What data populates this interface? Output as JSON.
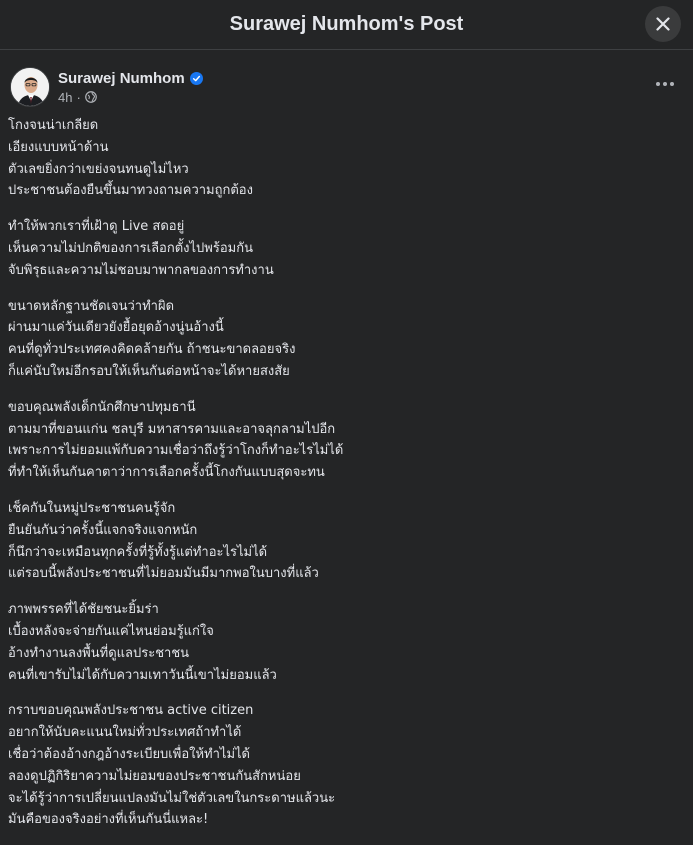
{
  "header": {
    "title": "Surawej Numhom's Post",
    "close_icon": "close-icon"
  },
  "post": {
    "author": "Surawej Numhom",
    "verified": true,
    "time": "4h",
    "dot": "·",
    "privacy_icon": "globe-icon",
    "menu_icon": "more-icon",
    "paragraphs": [
      [
        "โกงจนน่าเกลียด",
        "เอียงแบบหน้าด้าน",
        "ตัวเลขยิ่งกว่าเขย่งจนทนดูไม่ไหว",
        "ประชาชนต้องยืนขึ้นมาทวงถามความถูกต้อง"
      ],
      [
        "ทำให้พวกเราที่เฝ้าดู Live สดอยู่",
        "เห็นความไม่ปกติของการเลือกตั้งไปพร้อมกัน",
        "จับพิรุธและความไม่ชอบมาพากลของการทำงาน"
      ],
      [
        "ขนาดหลักฐานชัดเจนว่าทำผิด",
        "ผ่านมาแค่วันเดียวยังยื้อยุดอ้างนู่นอ้างนี้",
        "คนที่ดูทั่วประเทศคงคิดคล้ายกัน ถ้าชนะขาดลอยจริง",
        "ก็แค่นับใหม่อีกรอบให้เห็นกันต่อหน้าจะได้หายสงสัย"
      ],
      [
        "ขอบคุณพลังเด็กนักศึกษาปทุมธานี",
        "ตามมาที่ขอนแก่น ชลบุรี มหาสารคามและอาจลุกลามไปอีก",
        "เพราะการไม่ยอมแพ้กับความเชื่อว่าถึงรู้ว่าโกงก็ทำอะไรไม่ได้",
        "ที่ทำให้เห็นกันคาตาว่าการเลือกครั้งนี้โกงกันแบบสุดจะทน"
      ],
      [
        "เช็คกันในหมู่ประชาชนคนรู้จัก",
        "ยืนยันกันว่าครั้งนี้แจกจริงแจกหนัก",
        "ก็นึกว่าจะเหมือนทุกครั้งที่รู้ทั้งรู้แต่ทำอะไรไม่ได้",
        "แต่รอบนี้พลังประชาชนที่ไม่ยอมมันมีมากพอในบางที่แล้ว"
      ],
      [
        "ภาพพรรคที่ได้ชัยชนะยิ้มร่า",
        "เบื้องหลังจะจ่ายกันแค่ไหนย่อมรู้แก่ใจ",
        "อ้างทำงานลงพื้นที่ดูแลประชาชน",
        "คนที่เขารับไม่ได้กับความเทาวันนี้เขาไม่ยอมแล้ว"
      ],
      [
        "กราบขอบคุณพลังประชาชน active citizen",
        "อยากให้นับคะแนนใหม่ทั่วประเทศถ้าทำได้",
        "เชื่อว่าต้องอ้างกฎอ้างระเบียบเพื่อให้ทำไม่ได้",
        "ลองดูปฏิกิริยาความไม่ยอมของประชาชนกันสักหน่อย",
        "จะได้รู้ว่าการเปลี่ยนแปลงมันไม่ใช่ตัวเลขในกระดาษแล้วนะ",
        "มันคือของจริงอย่างที่เห็นกันนี่แหละ!"
      ]
    ]
  },
  "colors": {
    "background": "#242526",
    "text": "#e4e6eb",
    "secondary_text": "#b0b3b8",
    "verified_badge": "#1877f2",
    "close_button_bg": "#3a3b3c"
  }
}
